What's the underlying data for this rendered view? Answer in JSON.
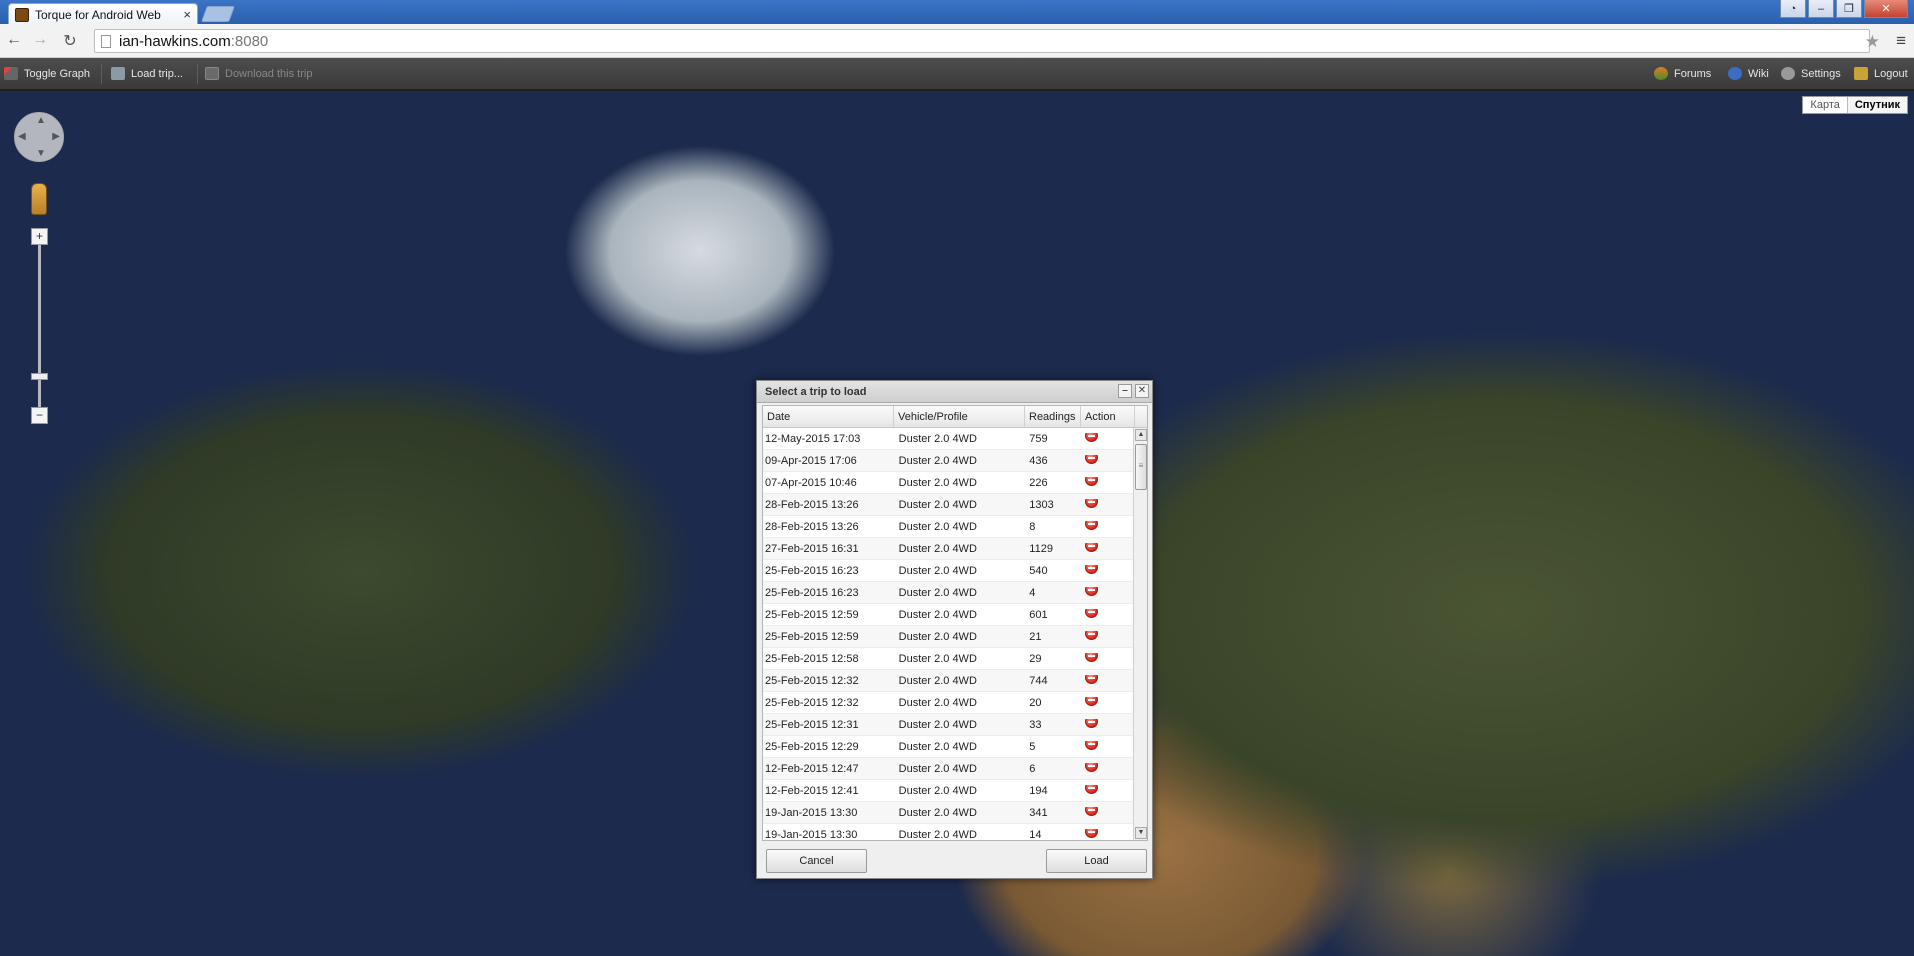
{
  "browser": {
    "tab_title": "Torque for Android Web  ",
    "url_host": "ian-hawkins.com",
    "url_port": ":8080"
  },
  "appbar": {
    "toggle_graph": "Toggle Graph",
    "load_trip": "Load trip...",
    "download_trip": "Download this trip",
    "forums": "Forums",
    "wiki": "Wiki",
    "settings": "Settings",
    "logout": "Logout"
  },
  "map": {
    "type_map": "Карта",
    "type_satellite": "Спутник"
  },
  "dialog": {
    "title": "Select a trip to load",
    "columns": {
      "date": "Date",
      "vehicle": "Vehicle/Profile",
      "readings": "Readings",
      "action": "Action"
    },
    "rows": [
      {
        "date": "12-May-2015 17:03",
        "vehicle": "Duster 2.0 4WD",
        "readings": "759"
      },
      {
        "date": "09-Apr-2015 17:06",
        "vehicle": "Duster 2.0 4WD",
        "readings": "436"
      },
      {
        "date": "07-Apr-2015 10:46",
        "vehicle": "Duster 2.0 4WD",
        "readings": "226"
      },
      {
        "date": "28-Feb-2015 13:26",
        "vehicle": "Duster 2.0 4WD",
        "readings": "1303"
      },
      {
        "date": "28-Feb-2015 13:26",
        "vehicle": "Duster 2.0 4WD",
        "readings": "8"
      },
      {
        "date": "27-Feb-2015 16:31",
        "vehicle": "Duster 2.0 4WD",
        "readings": "1129"
      },
      {
        "date": "25-Feb-2015 16:23",
        "vehicle": "Duster 2.0 4WD",
        "readings": "540"
      },
      {
        "date": "25-Feb-2015 16:23",
        "vehicle": "Duster 2.0 4WD",
        "readings": "4"
      },
      {
        "date": "25-Feb-2015 12:59",
        "vehicle": "Duster 2.0 4WD",
        "readings": "601"
      },
      {
        "date": "25-Feb-2015 12:59",
        "vehicle": "Duster 2.0 4WD",
        "readings": "21"
      },
      {
        "date": "25-Feb-2015 12:58",
        "vehicle": "Duster 2.0 4WD",
        "readings": "29"
      },
      {
        "date": "25-Feb-2015 12:32",
        "vehicle": "Duster 2.0 4WD",
        "readings": "744"
      },
      {
        "date": "25-Feb-2015 12:32",
        "vehicle": "Duster 2.0 4WD",
        "readings": "20"
      },
      {
        "date": "25-Feb-2015 12:31",
        "vehicle": "Duster 2.0 4WD",
        "readings": "33"
      },
      {
        "date": "25-Feb-2015 12:29",
        "vehicle": "Duster 2.0 4WD",
        "readings": "5"
      },
      {
        "date": "12-Feb-2015 12:47",
        "vehicle": "Duster 2.0 4WD",
        "readings": "6"
      },
      {
        "date": "12-Feb-2015 12:41",
        "vehicle": "Duster 2.0 4WD",
        "readings": "194"
      },
      {
        "date": "19-Jan-2015 13:30",
        "vehicle": "Duster 2.0 4WD",
        "readings": "341"
      },
      {
        "date": "19-Jan-2015 13:30",
        "vehicle": "Duster 2.0 4WD",
        "readings": "14"
      }
    ],
    "cancel_label": "Cancel",
    "load_label": "Load"
  }
}
